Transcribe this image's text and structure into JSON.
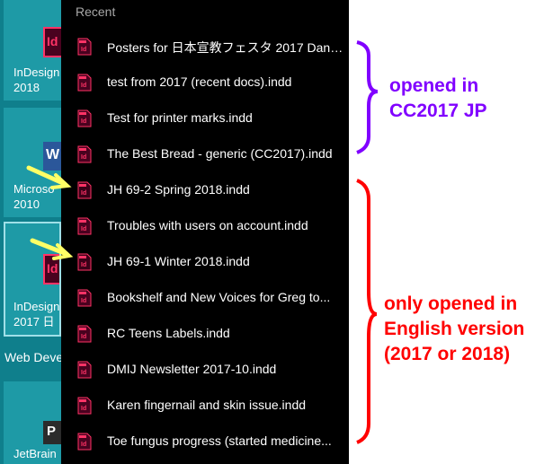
{
  "tiles": [
    {
      "label": "InDesign\n2018"
    },
    {
      "label": "Microso\n2010"
    },
    {
      "label": "InDesign\n2017 日"
    },
    {
      "label": "JetBrain"
    }
  ],
  "group_header": "Web Deve",
  "jumplist": {
    "header": "Recent",
    "items": [
      {
        "name": "Posters for 日本宣教フェスタ 2017 Dan.in...",
        "icon": "indesign-doc-icon"
      },
      {
        "name": "test from 2017 (recent docs).indd",
        "icon": "indesign-doc-icon"
      },
      {
        "name": "Test for printer marks.indd",
        "icon": "indesign-doc-icon"
      },
      {
        "name": "The Best Bread - generic (CC2017).indd",
        "icon": "indesign-doc-icon"
      },
      {
        "name": "JH 69-2 Spring 2018.indd",
        "icon": "indesign-2018-doc-icon"
      },
      {
        "name": "Troubles with users on account.indd",
        "icon": "indesign-doc-icon"
      },
      {
        "name": "JH 69-1 Winter 2018.indd",
        "icon": "indesign-2018-doc-icon"
      },
      {
        "name": "Bookshelf and New Voices for Greg to...",
        "icon": "indesign-doc-icon"
      },
      {
        "name": "RC Teens Labels.indd",
        "icon": "indesign-doc-icon"
      },
      {
        "name": "DMIJ Newsletter 2017-10.indd",
        "icon": "indesign-doc-icon"
      },
      {
        "name": "Karen fingernail and skin issue.indd",
        "icon": "indesign-doc-icon"
      },
      {
        "name": "Toe fungus progress (started medicine...",
        "icon": "indesign-doc-icon"
      }
    ]
  },
  "annotations": {
    "purple": "opened in\nCC2017 JP",
    "red": "only opened in\nEnglish version\n(2017 or 2018)"
  },
  "colors": {
    "indesign_pink": "#ff3366",
    "indesign_dark": "#49021f",
    "annotation_purple": "#8000ff",
    "annotation_red": "#ff0000",
    "arrow_yellow": "#ffff66"
  }
}
